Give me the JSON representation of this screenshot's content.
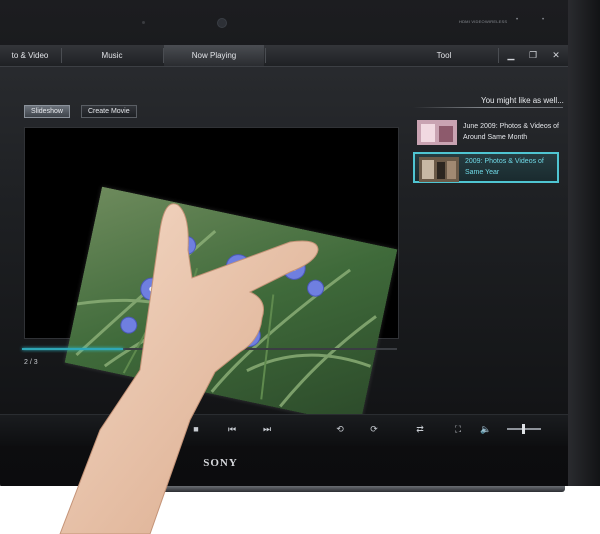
{
  "device": {
    "brand": "SONY",
    "hw_labels": [
      "HDMI VIDEO",
      "WIRELESS"
    ]
  },
  "menubar": {
    "items": [
      {
        "label": "to & Video"
      },
      {
        "label": "Music"
      },
      {
        "label": "Now Playing"
      },
      {
        "label": "Tool"
      }
    ],
    "active_index": 2,
    "window_controls": [
      "minimize-icon",
      "restore-icon",
      "close-icon"
    ]
  },
  "toolbar": {
    "slideshow_label": "Slideshow",
    "create_movie_label": "Create Movie"
  },
  "sidebar": {
    "heading": "You might like as well...",
    "items": [
      {
        "title": "June 2009: Photos & Videos of Around Same Month",
        "selected": false
      },
      {
        "title": "2009: Photos & Videos of Same Year",
        "selected": true
      }
    ]
  },
  "player": {
    "page": "2 / 3",
    "progress_fraction": 0.27
  },
  "controls": {
    "icons": [
      "stop-icon",
      "previous-icon",
      "next-icon",
      "rotate-left-icon",
      "rotate-right-icon",
      "repeat-icon",
      "fullscreen-icon",
      "volume-icon"
    ],
    "volume_fraction": 0.45
  },
  "colors": {
    "accent": "#4fc5d2",
    "menubar": "#2a2c30",
    "background": "#1e2023"
  }
}
